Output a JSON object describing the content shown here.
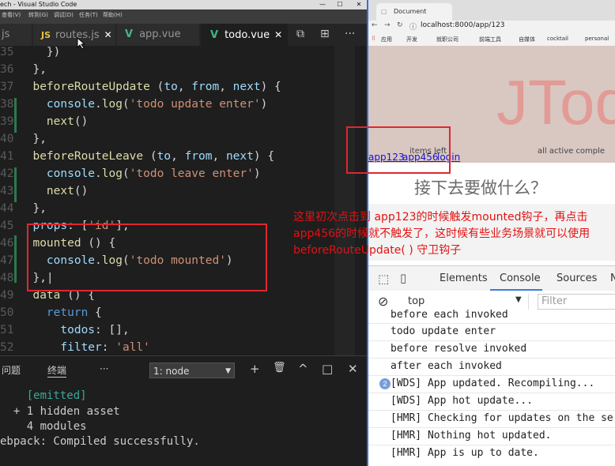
{
  "vscode": {
    "title": "ech - Visual Studio Code",
    "controls": {
      "minimize": "—",
      "maximize": "☐",
      "close": "✕"
    },
    "menu": [
      "查看(V)",
      "转到(G)",
      "调试(D)",
      "任务(T)",
      "帮助(H)"
    ],
    "tabs": [
      {
        "icon": "",
        "label": "js",
        "active": false
      },
      {
        "icon": "JS",
        "label": "routes.js",
        "active": false
      },
      {
        "icon": "V",
        "label": "app.vue",
        "active": false
      },
      {
        "icon": "V",
        "label": "todo.vue",
        "active": true
      }
    ],
    "tab_close": "✕",
    "editor_actions": [
      "⧉",
      "⊞",
      "···"
    ],
    "line_numbers": [
      "35",
      "36",
      "37",
      "38",
      "39",
      "40",
      "41",
      "42",
      "43",
      "44",
      "45",
      "46",
      "47",
      "48",
      "49",
      "50",
      "51",
      "52"
    ],
    "panel": {
      "tab_problems": "问题",
      "tab_terminal": "终端",
      "more": "···",
      "terminal_select": "1: node",
      "actions": [
        "+",
        "🗑",
        "^",
        "□",
        "✕"
      ],
      "output": [
        "    [emitted]",
        "  + 1 hidden asset",
        "    4 modules",
        "ebpack: Compiled successfully."
      ]
    }
  },
  "chrome": {
    "tab_title": "Document",
    "url": "localhost:8000/app/123",
    "bookmarks": [
      "应用",
      "开发",
      "就职公司",
      "前端工具",
      "自媒体",
      "cocktail",
      "personal"
    ],
    "page_title": "JTodo",
    "tabs_hint": "items left",
    "filter_hint": "all   active   comple",
    "links": [
      "app123",
      "app456",
      "login"
    ],
    "question": "接下去要做什么？",
    "devtools": {
      "tabs": [
        "Elements",
        "Console",
        "Sources",
        "N"
      ],
      "context": "top",
      "filter_placeholder": "Filter",
      "messages": [
        "before each invoked",
        "todo update enter",
        "before resolve invoked",
        "after each invoked",
        "[WDS] App updated. Recompiling...",
        "[WDS] App hot update...",
        "[HMR] Checking for updates on the serv",
        "[HMR] Nothing hot updated.",
        "[HMR] App is up to date."
      ],
      "badge_count": "2"
    }
  },
  "annotation": "这里初次点击到 app123的时候触发mounted钩子，再点击app456的时候就不触发了，这时候有些业务场景就可以使用beforeRouteUpdate( ) 守卫钩子",
  "colors": {
    "annotation": "#e21212",
    "accent": "#3a7be0"
  }
}
